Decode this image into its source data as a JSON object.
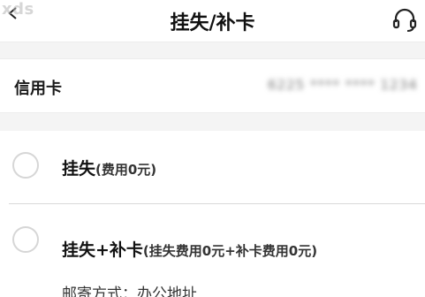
{
  "header": {
    "title": "挂失/补卡",
    "watermark": "xds"
  },
  "card": {
    "label": "信用卡",
    "number_masked": "6225 **** **** 1234"
  },
  "options": [
    {
      "main": "挂失",
      "note": "(费用0元)"
    },
    {
      "main": "挂失+补卡",
      "note": "(挂失费用0元+补卡费用0元)"
    }
  ],
  "mail": {
    "text": "邮寄方式：办公地址"
  },
  "icons": {
    "back": "back-arrow-icon",
    "headset": "headset-icon"
  }
}
